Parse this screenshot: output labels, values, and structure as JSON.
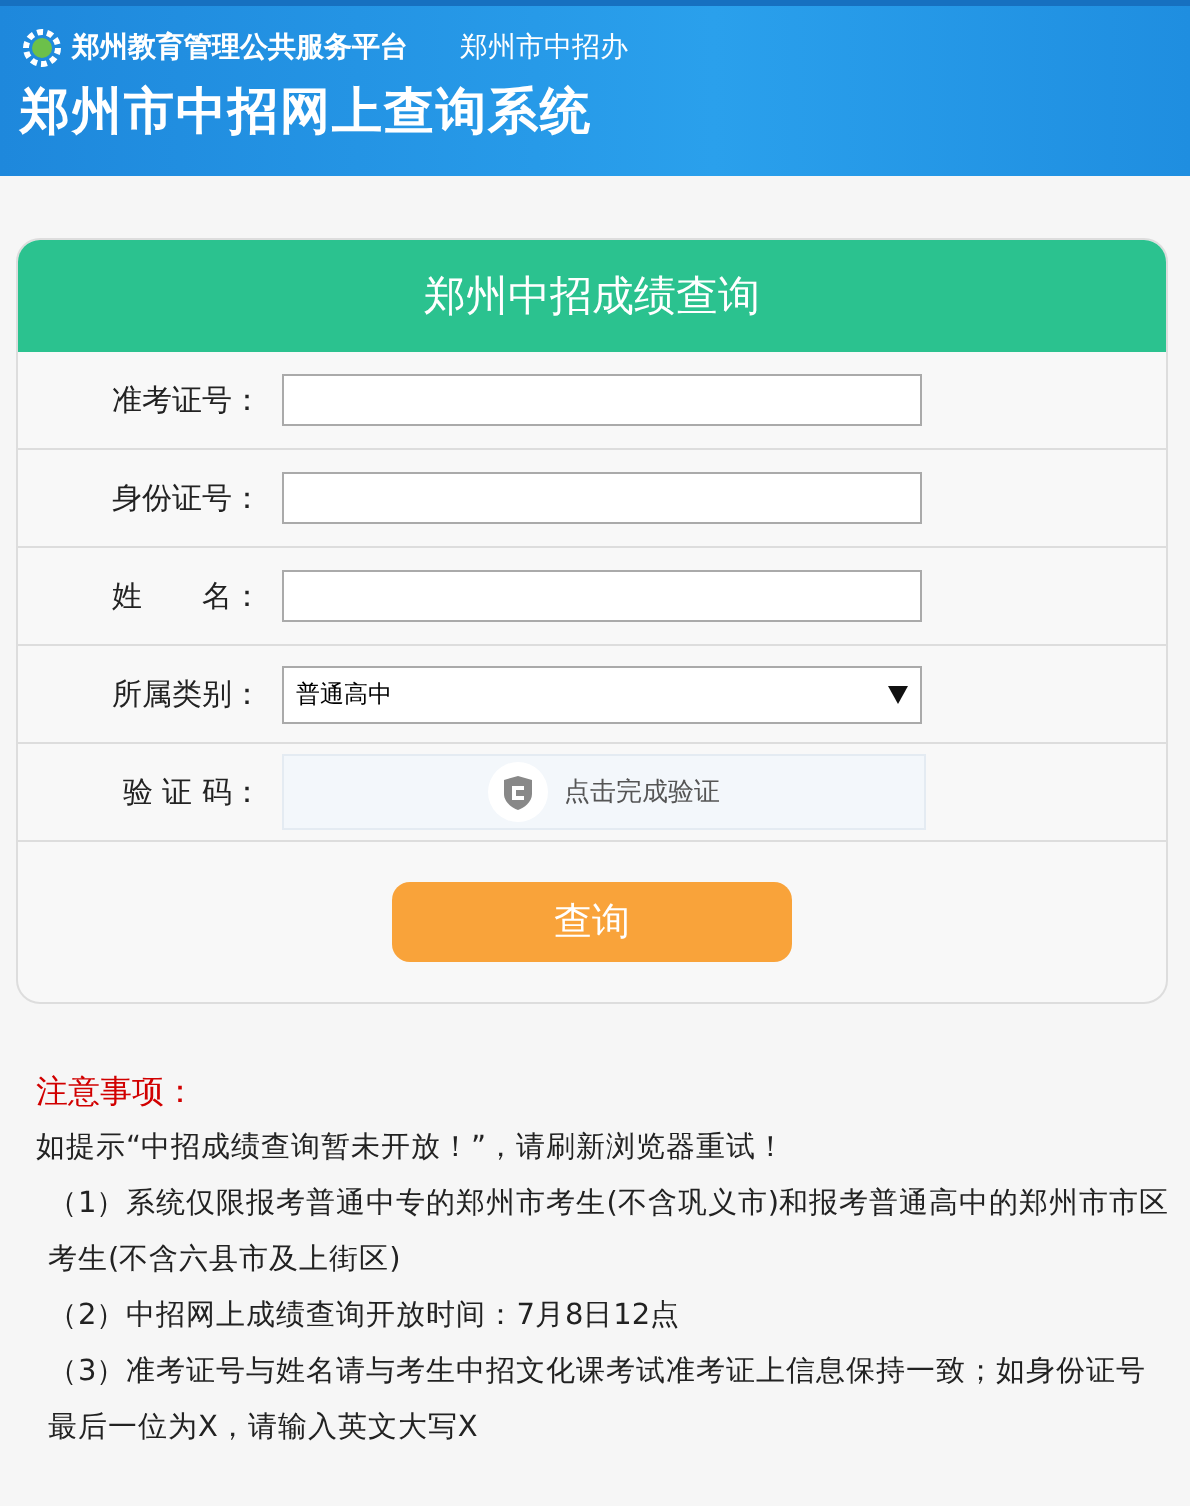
{
  "header": {
    "platform": "郑州教育管理公共服务平台",
    "office": "郑州市中招办",
    "title": "郑州市中招网上查询系统"
  },
  "form": {
    "title": "郑州中招成绩查询",
    "fields": [
      {
        "kind": "text",
        "label": "准考证号："
      },
      {
        "kind": "text",
        "label": "身份证号："
      },
      {
        "kind": "text",
        "label": "姓　　名："
      },
      {
        "kind": "select",
        "label": "所属类别：",
        "value": "普通高中"
      },
      {
        "kind": "captcha",
        "label": "验 证 码：",
        "value": "点击完成验证"
      }
    ],
    "submit": "查询"
  },
  "notes": {
    "title": "注意事项：",
    "lines": [
      "如提示“中招成绩查询暂未开放！”，请刷新浏览器重试！",
      "（1）系统仅限报考普通中专的郑州市考生(不含巩义市)和报考普通高中的郑州市市区考生(不含六县市及上街区)",
      "（2）中招网上成绩查询开放时间：7月8日12点",
      "（3）准考证号与姓名请与考生中招文化课考试准考证上信息保持一致；如身份证号最后一位为X，请输入英文大写X"
    ]
  }
}
